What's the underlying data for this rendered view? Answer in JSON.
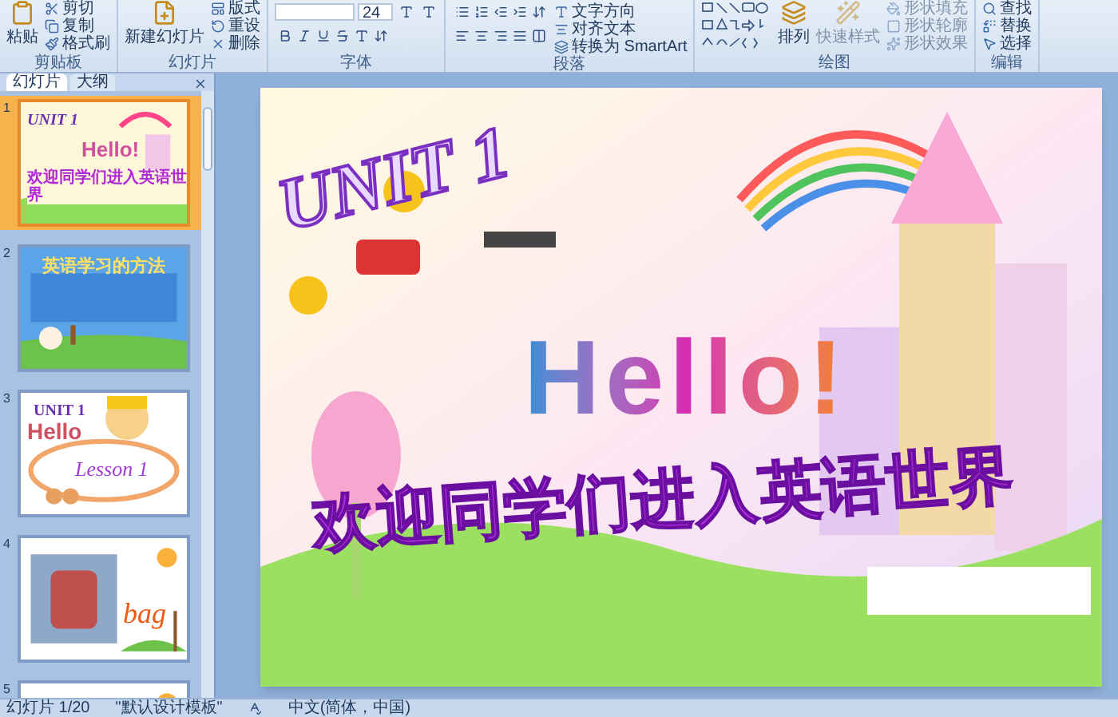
{
  "ribbon": {
    "groups": [
      {
        "kind": "clipboard",
        "label": "剪贴板",
        "items": [
          "粘贴",
          "剪切",
          "复制",
          "格式刷"
        ]
      },
      {
        "kind": "slides",
        "label": "幻灯片",
        "items": [
          "新建幻灯片",
          "版式",
          "重设",
          "删除"
        ]
      },
      {
        "kind": "font",
        "label": "字体",
        "font_size": "24"
      },
      {
        "kind": "paragraph",
        "label": "段落",
        "items": [
          "文字方向",
          "对齐文本",
          "转换为 SmartArt"
        ]
      },
      {
        "kind": "drawing",
        "label": "绘图",
        "items": [
          {
            "label": "排列",
            "disabled": false
          },
          {
            "label": "快速样式",
            "disabled": true
          },
          {
            "label": "形状填充",
            "disabled": true
          },
          {
            "label": "形状轮廓",
            "disabled": true
          },
          {
            "label": "形状效果",
            "disabled": true
          }
        ]
      },
      {
        "kind": "editing",
        "label": "编辑",
        "items": [
          "查找",
          "替换",
          "选择"
        ]
      }
    ]
  },
  "panel": {
    "tabs": [
      {
        "label": "幻灯片",
        "selected": true
      },
      {
        "label": "大纲",
        "selected": false
      }
    ],
    "thumbnails": [
      {
        "number": "1",
        "selected": true,
        "kind": "welcome",
        "unit": "UNIT 1",
        "greeting": "Hello!",
        "title": "欢迎同学们进入英语世界"
      },
      {
        "number": "2",
        "selected": false,
        "kind": "methods",
        "title": "英语学习的方法"
      },
      {
        "number": "3",
        "selected": false,
        "kind": "lesson",
        "unit": "UNIT 1",
        "greeting": "Hello",
        "lesson": "Lesson 1"
      },
      {
        "number": "4",
        "selected": false,
        "kind": "vocab",
        "word": "bag"
      },
      {
        "number": "5",
        "selected": false
      }
    ]
  },
  "slide": {
    "unit": "UNIT 1",
    "greeting": "Hello!",
    "title": "欢迎同学们进入英语世界"
  },
  "status_bar": {
    "slide": "幻灯片 1/20",
    "theme": "\"默认设计模板\"",
    "language": "中文(简体，中国)"
  }
}
